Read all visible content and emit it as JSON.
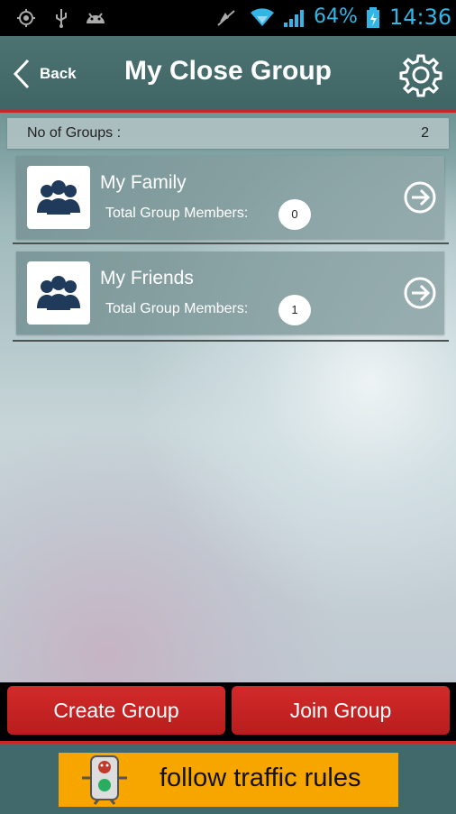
{
  "status_bar": {
    "battery_percent": "64%",
    "time": "14:36",
    "accent_color": "#33b5e5",
    "icons": [
      "gps-icon",
      "usb-icon",
      "android-debug-icon",
      "muted-icon",
      "wifi-icon",
      "signal-icon",
      "battery-charging-icon"
    ]
  },
  "header": {
    "back_label": "Back",
    "title": "My Close Group",
    "settings_icon": "gear-icon"
  },
  "summary": {
    "label": "No of Groups :",
    "value": "2"
  },
  "groups": [
    {
      "name": "My Family",
      "members_label": "Total Group Members:",
      "members_count": "0",
      "icon": "group-icon"
    },
    {
      "name": "My Friends",
      "members_label": "Total Group Members:",
      "members_count": "1",
      "icon": "group-icon"
    }
  ],
  "actions": {
    "create_label": "Create Group",
    "join_label": "Join Group"
  },
  "ad": {
    "text": "follow traffic rules",
    "mascot_icon": "traffic-light-mascot-icon"
  },
  "colors": {
    "header_bg": "#4d7272",
    "accent_red": "#c92727",
    "button_red": "#d32a2a",
    "ad_bg": "#f7a600"
  }
}
